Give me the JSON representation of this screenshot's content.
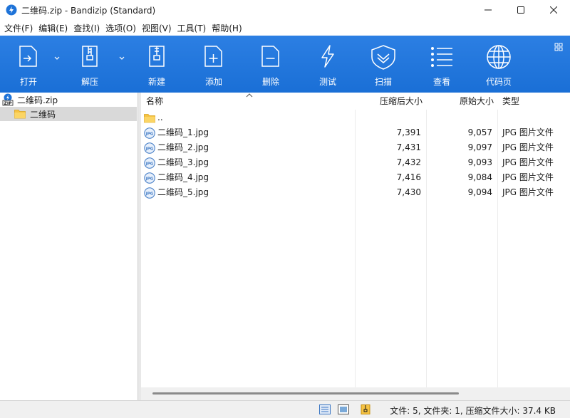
{
  "window": {
    "title": "二维码.zip - Bandizip (Standard)"
  },
  "menu": [
    "文件(F)",
    "编辑(E)",
    "查找(I)",
    "选项(O)",
    "视图(V)",
    "工具(T)",
    "帮助(H)"
  ],
  "toolbar": {
    "open": "打开",
    "extract": "解压",
    "new": "新建",
    "add": "添加",
    "delete": "删除",
    "test": "测试",
    "scan": "扫描",
    "view": "查看",
    "codepage": "代码页"
  },
  "tree": {
    "archive": "二维码.zip",
    "folder": "二维码"
  },
  "columns": {
    "name": "名称",
    "compressed": "压缩后大小",
    "original": "原始大小",
    "type": "类型"
  },
  "parent_dir": "..",
  "files": [
    {
      "name": "二维码_1.jpg",
      "compressed": "7,391",
      "original": "9,057",
      "type": "JPG 图片文件"
    },
    {
      "name": "二维码_2.jpg",
      "compressed": "7,431",
      "original": "9,097",
      "type": "JPG 图片文件"
    },
    {
      "name": "二维码_3.jpg",
      "compressed": "7,432",
      "original": "9,093",
      "type": "JPG 图片文件"
    },
    {
      "name": "二维码_4.jpg",
      "compressed": "7,416",
      "original": "9,084",
      "type": "JPG 图片文件"
    },
    {
      "name": "二维码_5.jpg",
      "compressed": "7,430",
      "original": "9,094",
      "type": "JPG 图片文件"
    }
  ],
  "status": {
    "summary": "文件: 5, 文件夹: 1, 压缩文件大小: 37.4 KB"
  },
  "icons": {
    "jpg_badge": "JPG",
    "zip_badge": "ZIP"
  },
  "colors": {
    "toolbar": "#1f74dc",
    "selection": "#d9d9d9"
  }
}
